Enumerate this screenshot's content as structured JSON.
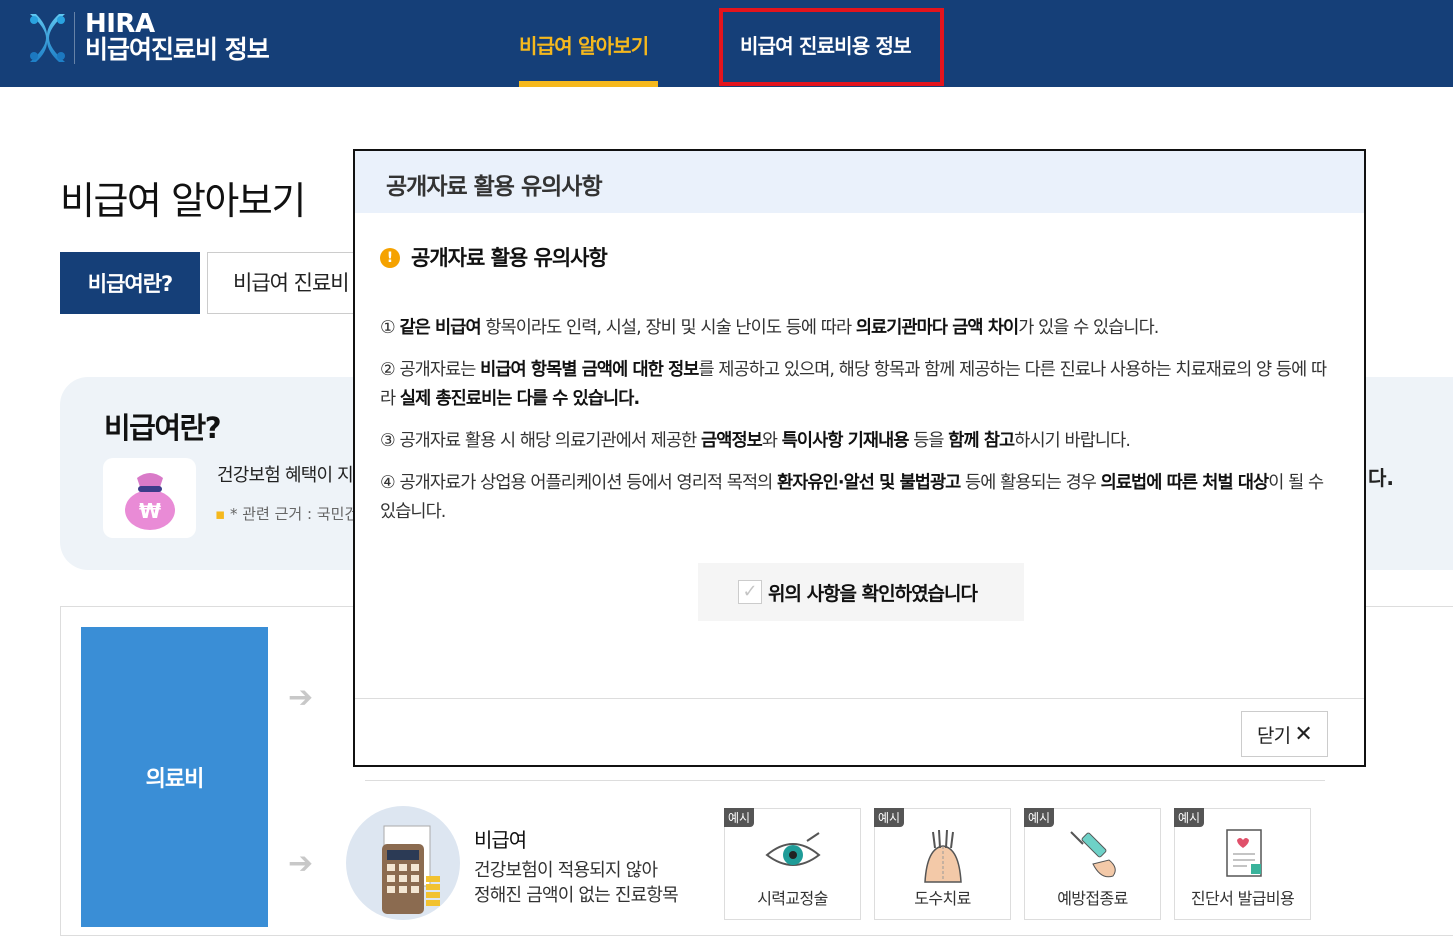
{
  "header": {
    "logo_line1": "HIRA",
    "logo_line2": "비급여진료비 정보",
    "nav": [
      {
        "label": "비급여 알아보기",
        "active": true
      },
      {
        "label": "비급여 진료비용 정보",
        "highlighted": true
      }
    ]
  },
  "page": {
    "title": "비급여 알아보기",
    "tabs": [
      "비급여란?",
      "비급여 진료비"
    ],
    "section_heading": "비급여란?",
    "info_text": "건강보험 혜택이 지",
    "info_note": "* 관련 근거 : 국민건",
    "trailing_text": "다.",
    "medical_fee_label": "의료비",
    "nonbenefit": {
      "title": "비급여",
      "desc_line1": "건강보험이 적용되지 않아",
      "desc_line2": "정해진 금액이 없는 진료항목"
    },
    "examples_badge": "예시",
    "examples": [
      {
        "label": "시력교정술",
        "icon": "eye-icon"
      },
      {
        "label": "도수치료",
        "icon": "manual-therapy-icon"
      },
      {
        "label": "예방접종료",
        "icon": "syringe-icon"
      },
      {
        "label": "진단서 발급비용",
        "icon": "certificate-icon"
      }
    ]
  },
  "modal": {
    "header_title": "공개자료 활용 유의사항",
    "warning_title": "공개자료 활용 유의사항",
    "warning_icon": "!",
    "notices": [
      {
        "num": "①",
        "parts": [
          {
            "t": " "
          },
          {
            "t": "같은 비급여",
            "b": true
          },
          {
            "t": " 항목이라도 인력, 시설, 장비 및 시술 난이도 등에 따라 "
          },
          {
            "t": "의료기관마다 금액 차이",
            "b": true
          },
          {
            "t": "가 있을 수 있습니다."
          }
        ]
      },
      {
        "num": "②",
        "parts": [
          {
            "t": " 공개자료는 "
          },
          {
            "t": "비급여 항목별 금액에 대한 정보",
            "b": true
          },
          {
            "t": "를 제공하고 있으며, 해당 항목과 함께 제공하는 다른 진료나 사용하는 치료재료의 양 등에 따라 "
          },
          {
            "t": "실제 총진료비는 다를 수 있습니다.",
            "b": true
          }
        ]
      },
      {
        "num": "③",
        "parts": [
          {
            "t": " 공개자료 활용 시 해당 의료기관에서 제공한 "
          },
          {
            "t": "금액정보",
            "b": true
          },
          {
            "t": "와 "
          },
          {
            "t": "특이사항 기재내용",
            "b": true
          },
          {
            "t": " 등을 "
          },
          {
            "t": "함께 참고",
            "b": true
          },
          {
            "t": "하시기 바랍니다."
          }
        ]
      },
      {
        "num": "④",
        "parts": [
          {
            "t": " 공개자료가 상업용 어플리케이션 등에서 영리적 목적의 "
          },
          {
            "t": "환자유인·알선 및 불법광고",
            "b": true
          },
          {
            "t": " 등에 활용되는 경우 "
          },
          {
            "t": "의료법에 따른 처벌 대상",
            "b": true
          },
          {
            "t": "이 될 수 있습니다."
          }
        ]
      }
    ],
    "confirm_label": "위의 사항을 확인하였습니다",
    "confirm_checked": false,
    "close_label": "닫기",
    "close_icon": "✕"
  },
  "colors": {
    "header_bg": "#153f78",
    "nav_active": "#f5b81d",
    "highlight_border": "#e3141d",
    "medfee_bg": "#3a8ed6",
    "warning": "#f5a200"
  }
}
